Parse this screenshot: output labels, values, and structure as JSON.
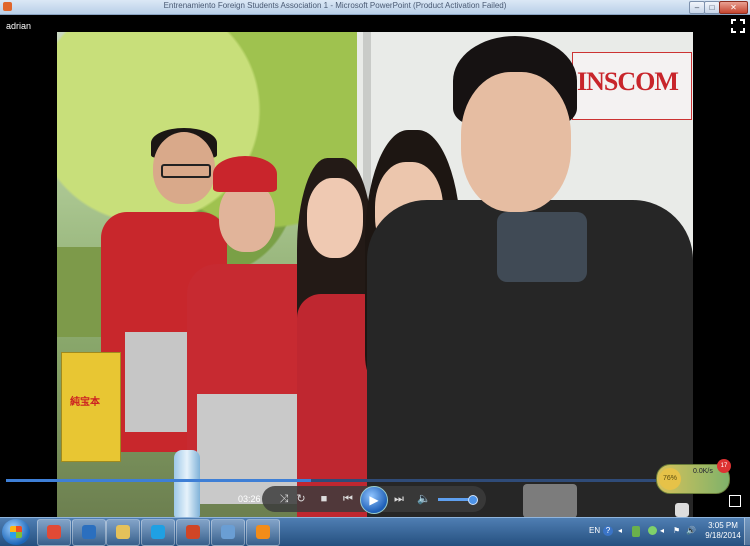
{
  "window": {
    "title": "Entrenamiento Foreign Students Association 1 - Microsoft PowerPoint (Product Activation Failed)",
    "minimize_glyph": "–",
    "maximize_glyph": "□",
    "close_glyph": "✕"
  },
  "slideshow": {
    "user_label": "adrian",
    "banner_text": "INSCOM",
    "box_text": "純宝本"
  },
  "player": {
    "time": "03:26",
    "progress_fraction": 0.44,
    "volume_fraction": 0.85,
    "buttons": {
      "shuffle": "⤨",
      "repeat": "↻",
      "stop": "■",
      "prev": "⏮",
      "play": "▶",
      "next": "⏭",
      "volume": "🔈"
    }
  },
  "net_widget": {
    "percent": "76%",
    "speed": "0.0K/s",
    "badge": "17"
  },
  "taskbar": {
    "apps": [
      {
        "name": "chrome-icon",
        "color": "#e14a35"
      },
      {
        "name": "media-player-icon",
        "color": "#2b6fbf"
      },
      {
        "name": "file-explorer-icon",
        "color": "#e5c15a"
      },
      {
        "name": "skype-icon",
        "color": "#1fa0e3"
      },
      {
        "name": "powerpoint-icon",
        "color": "#d04525"
      },
      {
        "name": "photo-viewer-icon",
        "color": "#6a9ed4"
      },
      {
        "name": "vlc-icon",
        "color": "#f28c19"
      }
    ],
    "tray": {
      "language": "EN",
      "help": "?",
      "arrow": "◂",
      "flag": "⚑",
      "volume": "🔊"
    },
    "clock_time": "3:05 PM",
    "clock_date": "9/18/2014"
  }
}
